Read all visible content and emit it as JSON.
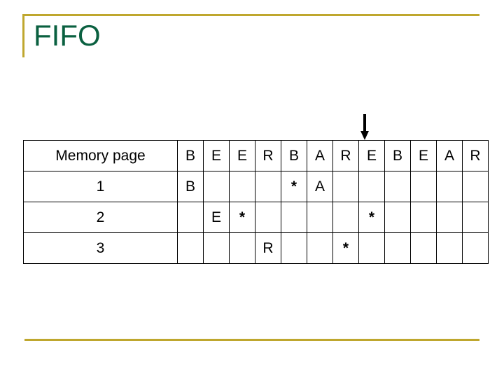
{
  "slide": {
    "title": "FIFO",
    "title_color": "#0A6040",
    "accent_color": "#BFA72E"
  },
  "pointer": {
    "icon": "down-arrow-icon",
    "points_to_column_index": 8,
    "points_to_reference": "E"
  },
  "table": {
    "row_label_header": "Memory page",
    "reference_string": [
      "B",
      "E",
      "E",
      "R",
      "B",
      "A",
      "R",
      "E",
      "B",
      "E",
      "A",
      "R"
    ],
    "letter_color": "#B476D9",
    "fault_marker_color": "#B01028",
    "fault_marker": "*",
    "rows": [
      {
        "label": "1",
        "cells": [
          "B",
          "",
          "",
          "",
          "*",
          "A",
          "",
          "",
          "",
          "",
          "",
          ""
        ]
      },
      {
        "label": "2",
        "cells": [
          "",
          "E",
          "*",
          "",
          "",
          "",
          "",
          "*",
          "",
          "",
          "",
          ""
        ]
      },
      {
        "label": "3",
        "cells": [
          "",
          "",
          "",
          "R",
          "",
          "",
          "*",
          "",
          "",
          "",
          "",
          ""
        ]
      }
    ]
  }
}
